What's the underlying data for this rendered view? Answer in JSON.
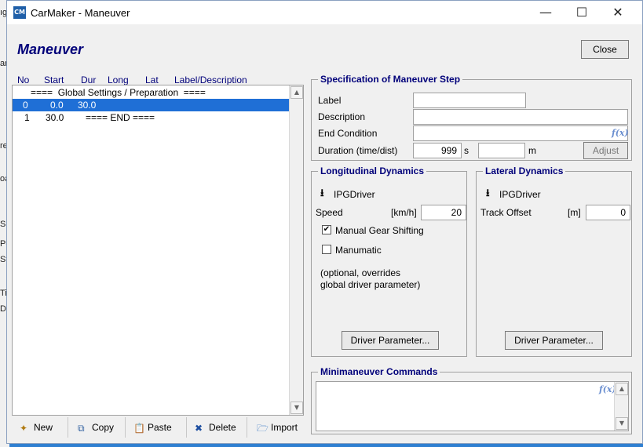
{
  "window": {
    "title": "CarMaker - Maneuver",
    "icon_text": "CM"
  },
  "background_fragments": [
    "ıg",
    "ar",
    "re",
    "oa",
    "S",
    "Pe",
    "St",
    "Ti",
    "Di"
  ],
  "heading": "Maneuver",
  "close_button": "Close",
  "list": {
    "columns": [
      "No",
      "Start",
      "Dur",
      "Long",
      "Lat",
      "Label/Description"
    ],
    "rows": [
      {
        "text": "====  Global Settings / Preparation  ===="
      },
      {
        "no": "0",
        "start": "0.0",
        "dur": "30.0",
        "selected": true
      },
      {
        "no": "1",
        "start": "30.0",
        "text": "==== END ===="
      }
    ]
  },
  "toolbar": {
    "new": "New",
    "copy": "Copy",
    "paste": "Paste",
    "delete": "Delete",
    "import": "Import"
  },
  "spec": {
    "legend": "Specification of Maneuver Step",
    "label_label": "Label",
    "label_value": "",
    "description_label": "Description",
    "description_value": "",
    "end_condition_label": "End Condition",
    "end_condition_value": "",
    "fx_icon": "f(x)",
    "duration_label": "Duration (time/dist)",
    "duration_value": "999",
    "duration_unit": "s",
    "distance_value": "",
    "distance_unit": "m",
    "adjust_button": "Adjust"
  },
  "longitudinal": {
    "legend": "Longitudinal Dynamics",
    "driver_label": "IPGDriver",
    "speed_label": "Speed",
    "speed_unit": "[km/h]",
    "speed_value": "20",
    "manual_gear_label": "Manual Gear Shifting",
    "manual_gear_checked": true,
    "manumatic_label": "Manumatic",
    "manumatic_checked": false,
    "note_line1": "(optional, overrides",
    "note_line2": "global driver parameter)",
    "driver_param_button": "Driver Parameter..."
  },
  "lateral": {
    "legend": "Lateral Dynamics",
    "driver_label": "IPGDriver",
    "track_offset_label": "Track Offset",
    "track_offset_unit": "[m]",
    "track_offset_value": "0",
    "driver_param_button": "Driver Parameter..."
  },
  "minimaneuver": {
    "legend": "Minimaneuver Commands",
    "fx_icon": "f(x)"
  },
  "colors": {
    "title_blue": "#00007a",
    "selection": "#1f6fd6",
    "desktop": "#2f7fd1"
  }
}
